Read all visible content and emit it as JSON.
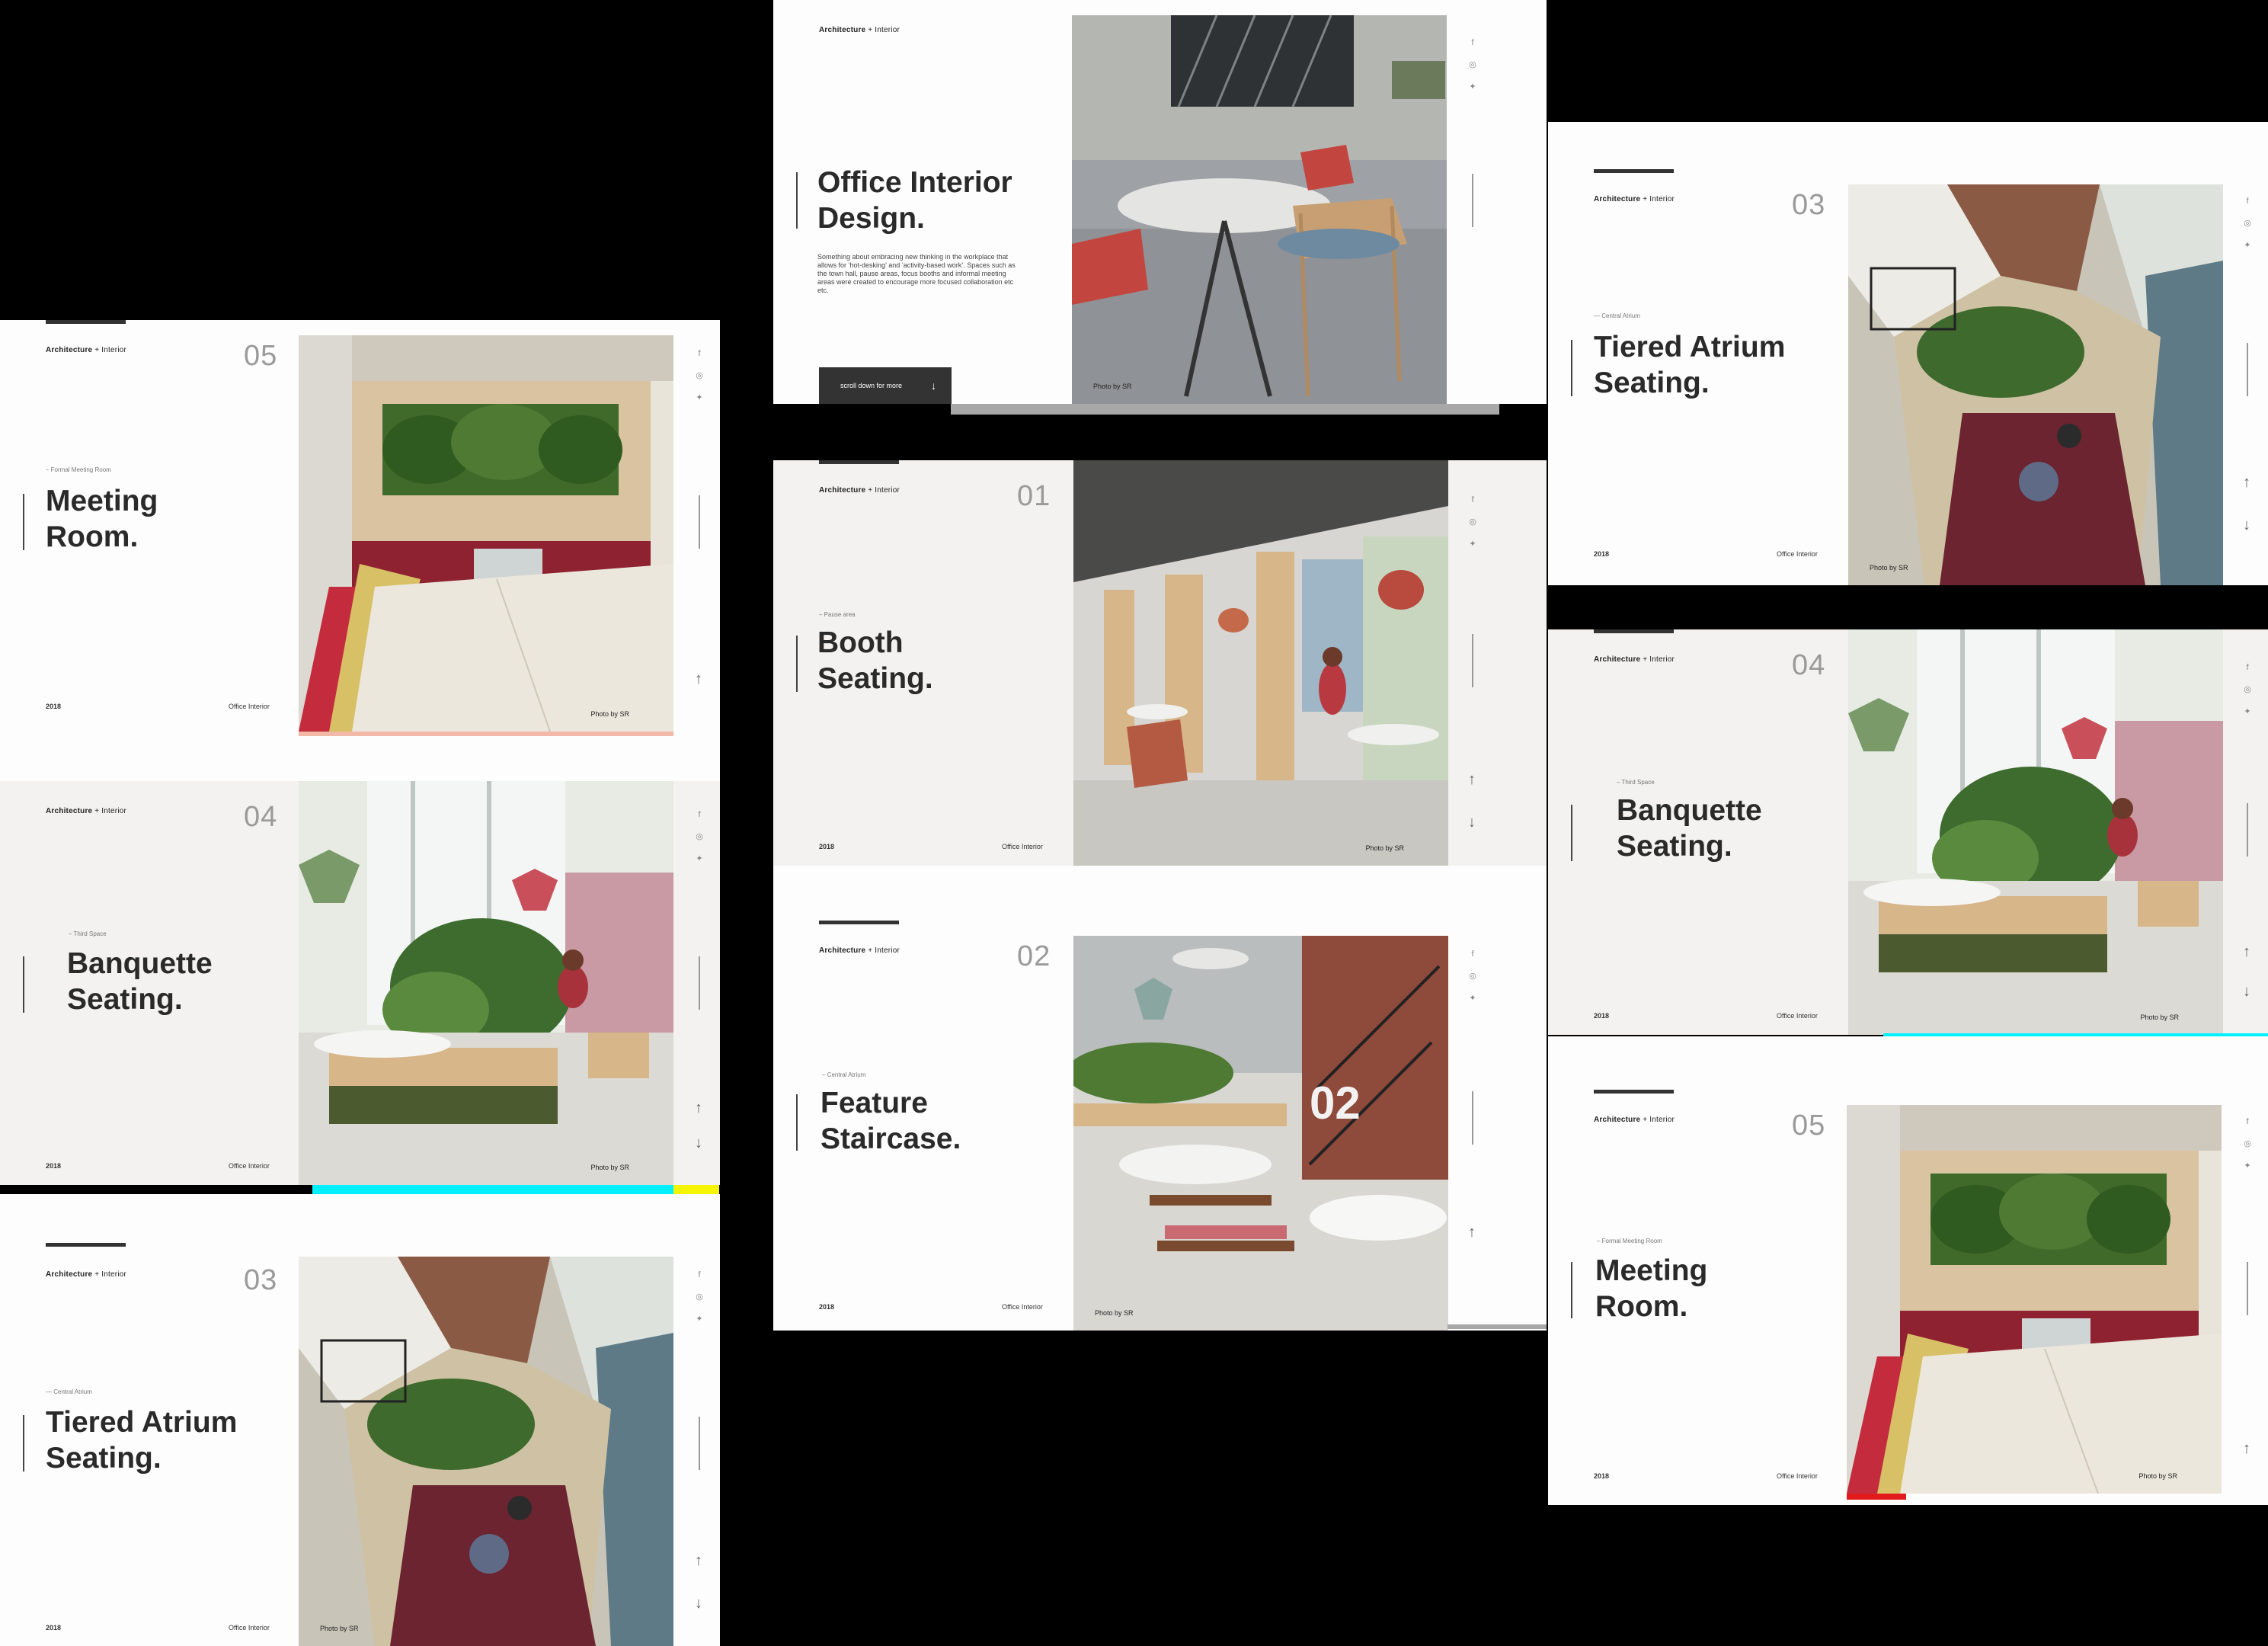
{
  "brand": {
    "bold": "Architecture",
    "rest": " + Interior"
  },
  "hero": {
    "title_line1": "Office Interior",
    "title_line2": "Design.",
    "description": "Something about embracing new thinking in the workplace that allows for ‘hot-desking’ and ‘activity-based work’. Spaces such as the town hall, pause areas, focus booths and informal meeting areas were created to encourage more focused collaboration etc etc.",
    "cta_label": "scroll down for more",
    "credit": "Photo by SR"
  },
  "slides": {
    "meeting": {
      "number": "05",
      "subtitle": "– Formal Meeting Room",
      "title_line1": "Meeting",
      "title_line2": "Room.",
      "year": "2018",
      "category": "Office Interior",
      "credit": "Photo by SR"
    },
    "banquette": {
      "number": "04",
      "subtitle": "– Third Space",
      "title_line1": "Banquette",
      "title_line2": "Seating.",
      "year": "2018",
      "category": "Office Interior",
      "credit": "Photo by SR"
    },
    "atrium": {
      "number": "03",
      "subtitle": "— Central Atrium",
      "title_line1": "Tiered Atrium",
      "title_line2": "Seating.",
      "year": "2018",
      "category": "Office Interior",
      "credit": "Photo by SR"
    },
    "booth": {
      "number": "01",
      "subtitle": "– Pause area",
      "title_line1": "Booth",
      "title_line2": "Seating.",
      "year": "2018",
      "category": "Office Interior",
      "credit": "Photo by SR"
    },
    "staircase": {
      "number": "02",
      "subtitle": "– Central Atrium",
      "title_line1": "Feature",
      "title_line2": "Staircase.",
      "year": "2018",
      "category": "Office Interior",
      "credit": "Photo by SR"
    }
  },
  "social": {
    "facebook": "f",
    "instagram": "◎",
    "twitter": "✦"
  },
  "arrows": {
    "up": "↑",
    "down": "↓"
  },
  "colors": {
    "accent_cyan": "#00f0ff",
    "accent_yellow": "#f5f500",
    "accent_pink": "#f2b8a8",
    "accent_red": "#e11b1b",
    "dark_button": "#333333"
  }
}
